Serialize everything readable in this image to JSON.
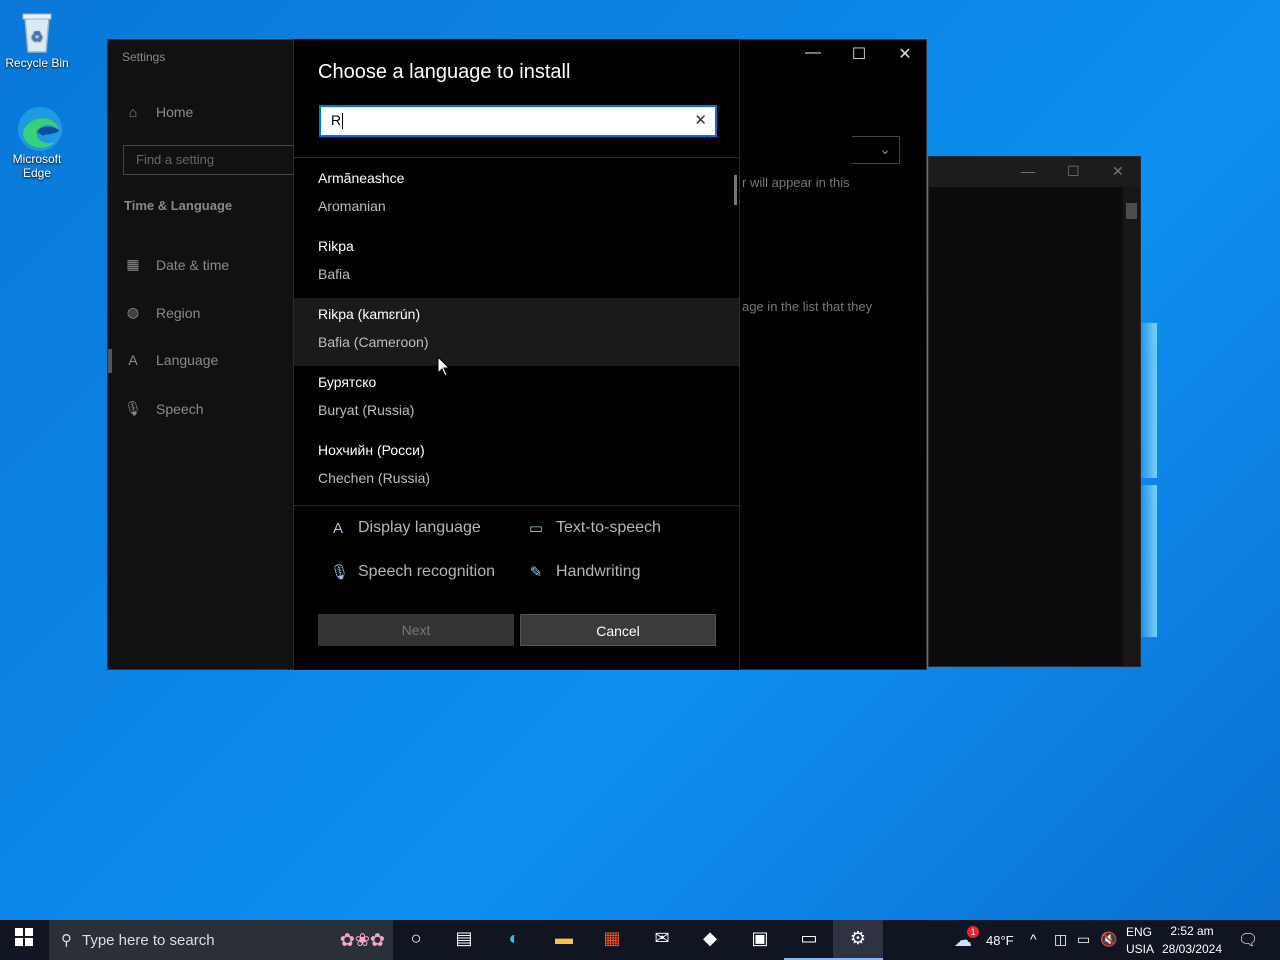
{
  "desktop": {
    "icons": [
      {
        "label": "Recycle Bin"
      },
      {
        "label": "Microsoft Edge"
      }
    ]
  },
  "settings": {
    "window_title": "Settings",
    "find_placeholder": "Find a setting",
    "home_label": "Home",
    "section_title": "Time & Language",
    "nav": [
      {
        "label": "Date & time"
      },
      {
        "label": "Region"
      },
      {
        "label": "Language"
      },
      {
        "label": "Speech"
      }
    ],
    "bg_text_1": "r will appear in this",
    "bg_text_2": "age in the list that they"
  },
  "dialog": {
    "title": "Choose a language to install",
    "search_value": "R",
    "languages": [
      {
        "native": "Armãneashce",
        "english": "Aromanian"
      },
      {
        "native": "Rikpa",
        "english": "Bafia"
      },
      {
        "native": "Rikpa (kamɛrún)",
        "english": "Bafia (Cameroon)"
      },
      {
        "native": "Бурятско",
        "english": "Buryat (Russia)"
      },
      {
        "native": "Нохчийн (Росси)",
        "english": "Chechen (Russia)"
      }
    ],
    "features": {
      "display_language": "Display language",
      "text_to_speech": "Text-to-speech",
      "speech_recognition": "Speech recognition",
      "handwriting": "Handwriting"
    },
    "next_label": "Next",
    "cancel_label": "Cancel"
  },
  "taskbar": {
    "search_placeholder": "Type here to search",
    "weather": "48°F",
    "weather_badge": "1",
    "lang_top": "ENG",
    "lang_bottom": "USIA",
    "time": "2:52 am",
    "date": "28/03/2024"
  }
}
